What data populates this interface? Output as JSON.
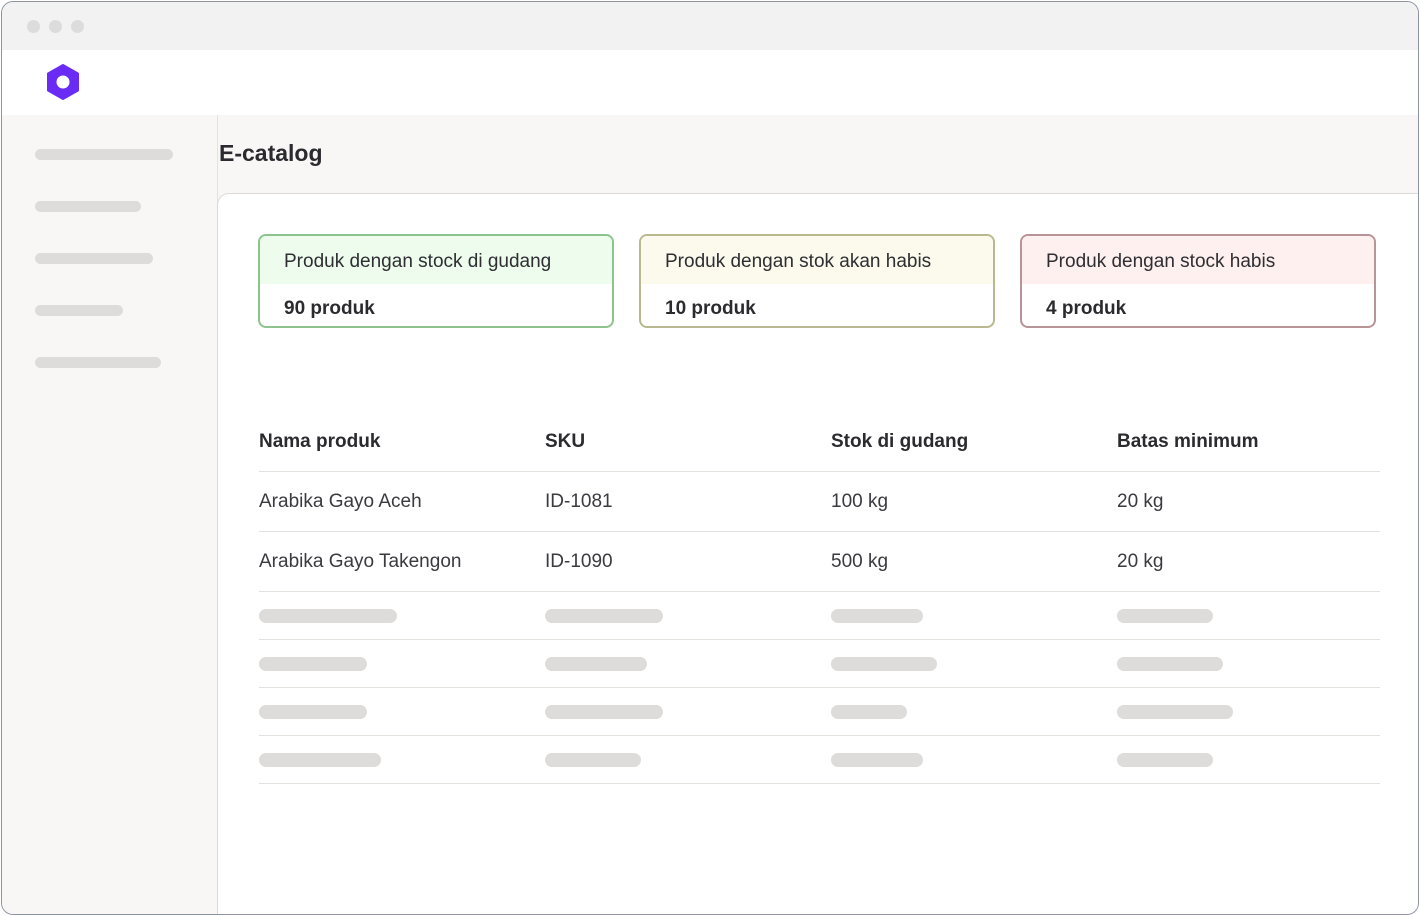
{
  "window": {
    "controls": [
      "close",
      "minimize",
      "maximize"
    ]
  },
  "app": {
    "logo_icon": "hexagon-logo-icon",
    "brand_color": "#6a2cf5"
  },
  "page": {
    "title": "E-catalog"
  },
  "summary_cards": [
    {
      "title": "Produk dengan stock di gudang",
      "value": "90 produk",
      "accent": "#8dc38d"
    },
    {
      "title": "Produk dengan stok akan habis",
      "value": "10 produk",
      "accent": "#b8b98f"
    },
    {
      "title": "Produk dengan stock habis",
      "value": "4 produk",
      "accent": "#b89497"
    }
  ],
  "table": {
    "columns": [
      "Nama produk",
      "SKU",
      "Stok di gudang",
      "Batas minimum"
    ],
    "rows": [
      [
        "Arabika Gayo Aceh",
        "ID-1081",
        "100 kg",
        "20 kg"
      ],
      [
        "Arabika Gayo Takengon",
        "ID-1090",
        "500 kg",
        "20 kg"
      ]
    ],
    "placeholder_rows": 4
  }
}
